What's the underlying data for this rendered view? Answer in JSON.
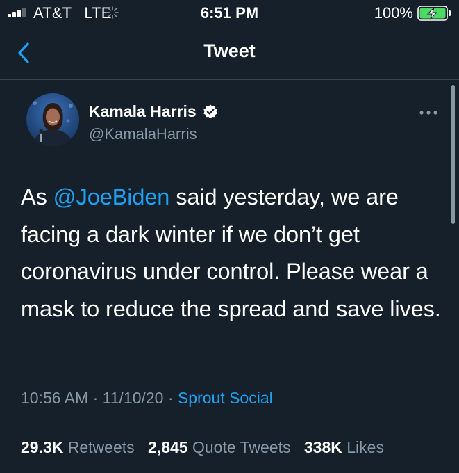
{
  "status_bar": {
    "carrier": "AT&T",
    "network": "LTE",
    "time": "6:51 PM",
    "battery": "100%",
    "signal_bars_filled": 3,
    "signal_bars_total": 4,
    "battery_level": 1.0,
    "battery_charging": true
  },
  "nav": {
    "title": "Tweet",
    "back_icon": "chevron-left-icon"
  },
  "tweet": {
    "author": {
      "name": "Kamala Harris",
      "handle": "@KamalaHarris",
      "verified": true
    },
    "text": {
      "before": "As ",
      "mention": "@JoeBiden",
      "after": " said yesterday, we are facing a dark winter if we don’t get coronavirus under control. Please wear a mask to reduce the spread and save lives."
    },
    "time": "10:56 AM",
    "separator": " · ",
    "date": "11/10/20",
    "source": "Sprout Social",
    "stats": {
      "retweets_count": "29.3K",
      "retweets_label": "Retweets",
      "quotes_count": "2,845",
      "quotes_label": "Quote Tweets",
      "likes_count": "338K",
      "likes_label": "Likes"
    }
  },
  "colors": {
    "background": "#15202b",
    "accent": "#1da1f2",
    "secondary_text": "#8899a6",
    "divider": "#38444d",
    "battery_fill": "#4cd964"
  }
}
